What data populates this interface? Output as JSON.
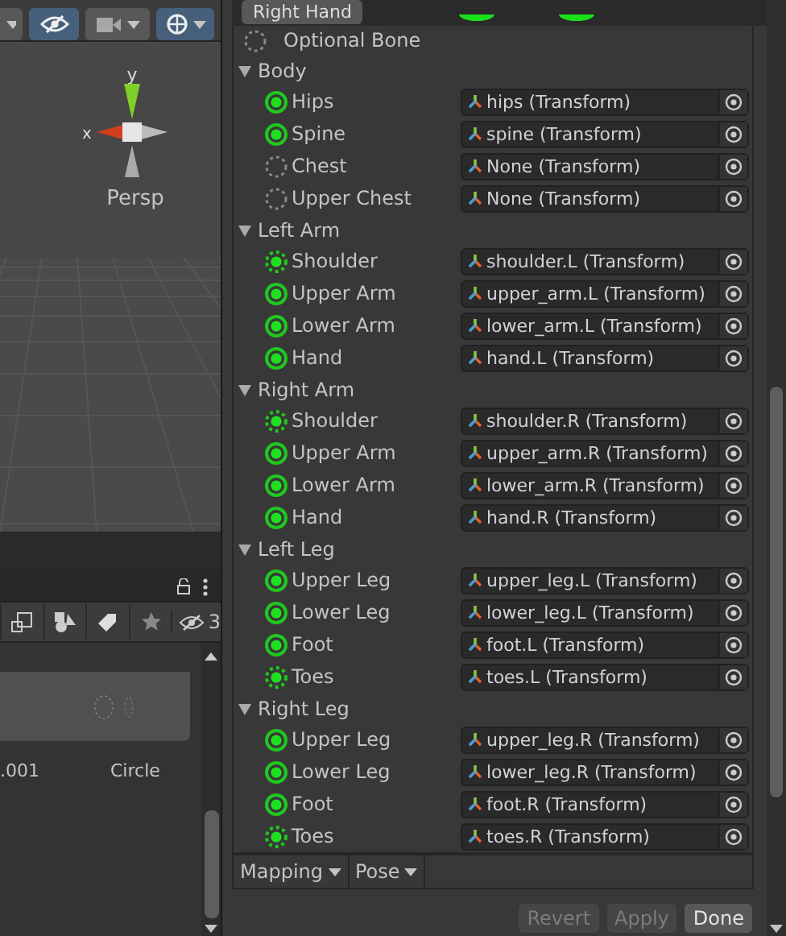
{
  "scene": {
    "persp_label": "Persp",
    "axis_y": "y",
    "axis_x": "x",
    "visibility_on": true,
    "gizmos_on": true
  },
  "project": {
    "hidden_count": "3",
    "assets": [
      {
        "name": ".001"
      },
      {
        "name": "Circle"
      }
    ]
  },
  "top_button": "Right Hand",
  "legend": {
    "label": "Optional Bone"
  },
  "groups": [
    {
      "name": "Body",
      "expanded": true,
      "bones": [
        {
          "name": "Hips",
          "kind": "required",
          "value": "hips (Transform)"
        },
        {
          "name": "Spine",
          "kind": "required",
          "value": "spine (Transform)"
        },
        {
          "name": "Chest",
          "kind": "optional-empty",
          "value": "None (Transform)"
        },
        {
          "name": "Upper Chest",
          "kind": "optional-empty",
          "value": "None (Transform)"
        }
      ]
    },
    {
      "name": "Left Arm",
      "expanded": true,
      "bones": [
        {
          "name": "Shoulder",
          "kind": "optional-mapped",
          "value": "shoulder.L (Transform)"
        },
        {
          "name": "Upper Arm",
          "kind": "required",
          "value": "upper_arm.L (Transform)"
        },
        {
          "name": "Lower Arm",
          "kind": "required",
          "value": "lower_arm.L (Transform)"
        },
        {
          "name": "Hand",
          "kind": "required",
          "value": "hand.L (Transform)"
        }
      ]
    },
    {
      "name": "Right Arm",
      "expanded": true,
      "bones": [
        {
          "name": "Shoulder",
          "kind": "optional-mapped",
          "value": "shoulder.R (Transform)"
        },
        {
          "name": "Upper Arm",
          "kind": "required",
          "value": "upper_arm.R (Transform)"
        },
        {
          "name": "Lower Arm",
          "kind": "required",
          "value": "lower_arm.R (Transform)"
        },
        {
          "name": "Hand",
          "kind": "required",
          "value": "hand.R (Transform)"
        }
      ]
    },
    {
      "name": "Left Leg",
      "expanded": true,
      "bones": [
        {
          "name": "Upper Leg",
          "kind": "required",
          "value": "upper_leg.L (Transform)"
        },
        {
          "name": "Lower Leg",
          "kind": "required",
          "value": "lower_leg.L (Transform)"
        },
        {
          "name": "Foot",
          "kind": "required",
          "value": "foot.L (Transform)"
        },
        {
          "name": "Toes",
          "kind": "optional-mapped",
          "value": "toes.L (Transform)"
        }
      ]
    },
    {
      "name": "Right Leg",
      "expanded": true,
      "bones": [
        {
          "name": "Upper Leg",
          "kind": "required",
          "value": "upper_leg.R (Transform)"
        },
        {
          "name": "Lower Leg",
          "kind": "required",
          "value": "lower_leg.R (Transform)"
        },
        {
          "name": "Foot",
          "kind": "required",
          "value": "foot.R (Transform)"
        },
        {
          "name": "Toes",
          "kind": "optional-mapped",
          "value": "toes.R (Transform)"
        }
      ]
    }
  ],
  "menus": [
    "Mapping",
    "Pose"
  ],
  "buttons": [
    {
      "label": "Revert",
      "disabled": true
    },
    {
      "label": "Apply",
      "disabled": true
    },
    {
      "label": "Done",
      "disabled": false
    }
  ]
}
